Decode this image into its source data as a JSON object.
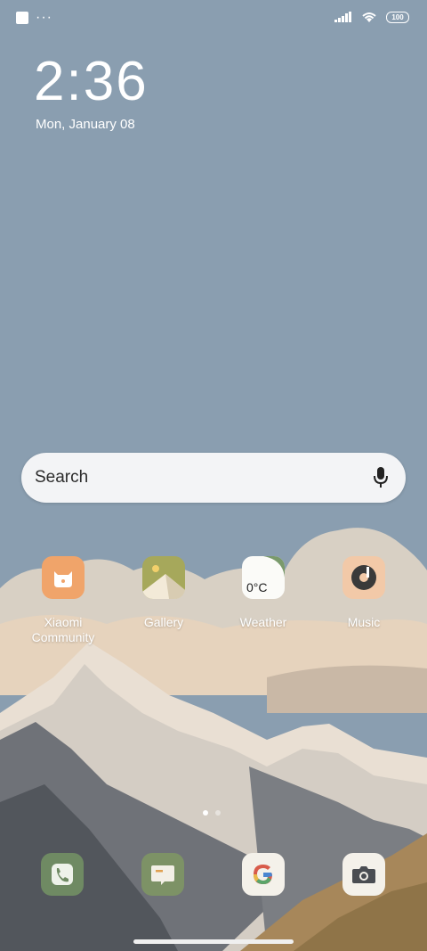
{
  "status_bar": {
    "battery": "100"
  },
  "clock": {
    "time": "2:36",
    "date": "Mon, January 08"
  },
  "search": {
    "placeholder": "Search"
  },
  "apps": [
    {
      "label": "Xiaomi Community",
      "icon": "xiaomi-community-icon"
    },
    {
      "label": "Gallery",
      "icon": "gallery-icon"
    },
    {
      "label": "Weather",
      "icon": "weather-icon",
      "badge": "0°C"
    },
    {
      "label": "Music",
      "icon": "music-icon"
    }
  ],
  "page_indicator": {
    "pages": 2,
    "current": 1
  },
  "dock": [
    {
      "icon": "phone-icon"
    },
    {
      "icon": "messages-icon"
    },
    {
      "icon": "google-icon"
    },
    {
      "icon": "camera-icon"
    }
  ],
  "colors": {
    "sky": "#8a9eb0",
    "search_bg": "#f3f4f6",
    "community_orange": "#f0a46a",
    "gallery_green": "#a6a85b",
    "phone_green": "#6f8a63",
    "music_peach": "#f2c9a8"
  }
}
